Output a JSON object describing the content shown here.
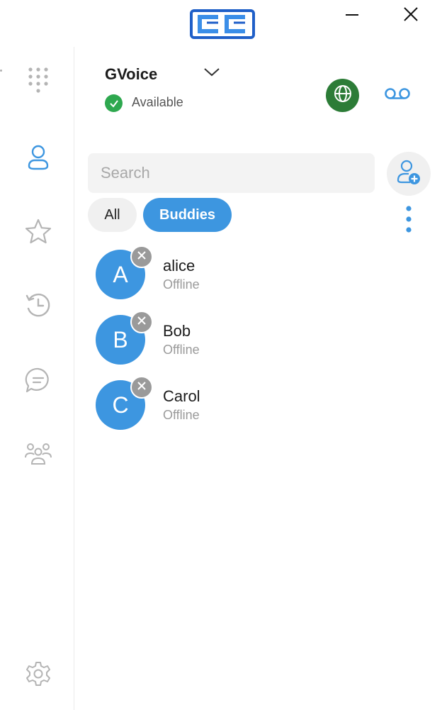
{
  "window": {
    "logo_icon": "cc-logo-icon",
    "minimize_icon": "minimize-icon",
    "close_icon": "close-icon"
  },
  "sidebar": {
    "items": [
      {
        "id": "dialpad",
        "icon": "dialpad-icon",
        "active": false
      },
      {
        "id": "contacts",
        "icon": "person-icon",
        "active": true
      },
      {
        "id": "favorites",
        "icon": "star-icon",
        "active": false
      },
      {
        "id": "history",
        "icon": "history-icon",
        "active": false
      },
      {
        "id": "messages",
        "icon": "chat-icon",
        "active": false
      },
      {
        "id": "groups",
        "icon": "group-icon",
        "active": false
      }
    ],
    "settings_icon": "gear-icon"
  },
  "account": {
    "name": "GVoice",
    "status": "Available",
    "status_color": "#2ea84f"
  },
  "header": {
    "globe_icon": "globe-icon",
    "globe_color": "#2c7c37",
    "voicemail_icon": "voicemail-icon"
  },
  "search": {
    "placeholder": "Search",
    "value": ""
  },
  "filters": {
    "all_label": "All",
    "buddies_label": "Buddies",
    "selected": "Buddies"
  },
  "accent_color": "#3d96e0",
  "contacts": [
    {
      "initial": "A",
      "name": "alice",
      "status": "Offline"
    },
    {
      "initial": "B",
      "name": "Bob",
      "status": "Offline"
    },
    {
      "initial": "C",
      "name": "Carol",
      "status": "Offline"
    }
  ]
}
